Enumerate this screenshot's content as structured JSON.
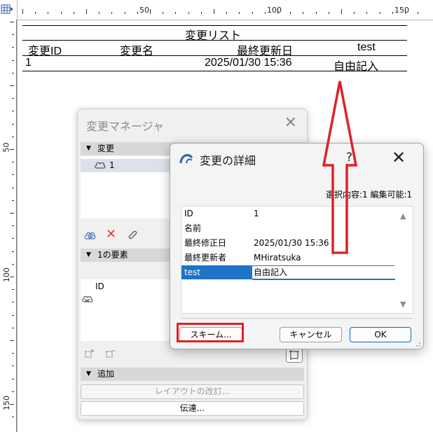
{
  "ruler": {
    "top_labels": [
      "50",
      "100",
      "150"
    ],
    "left_labels": [
      "50",
      "100",
      "150"
    ]
  },
  "change_list": {
    "title": "変更リスト",
    "columns": [
      "変更ID",
      "変更名",
      "最終更新日",
      "test"
    ],
    "rows": [
      {
        "id": "1",
        "name": "",
        "last_updated": "2025/01/30 15:36",
        "test": "自由記入"
      }
    ]
  },
  "change_manager": {
    "title": "変更マネージャ",
    "section_changes": "変更",
    "change_item": "1",
    "section_elements": "1の要素",
    "elements_column": "ID",
    "section_add": "追加",
    "layout_revision_button": "レイアウトの改訂...",
    "transmit_button": "伝達..."
  },
  "details_dialog": {
    "title": "変更の詳細",
    "help": "?",
    "status": "選択内容:1 編集可能:1",
    "properties": [
      {
        "key": "ID",
        "value": "1"
      },
      {
        "key": "名前",
        "value": ""
      },
      {
        "key": "最終修正日",
        "value": "2025/01/30 15:36"
      },
      {
        "key": "最終更新者",
        "value": "MHiratsuka"
      },
      {
        "key": "test",
        "value": "自由記入"
      }
    ],
    "scheme_button": "スキーム...",
    "cancel_button": "キャンセル",
    "ok_button": "OK"
  },
  "colors": {
    "highlight_red": "#e0202a",
    "selection_blue": "#1f73c7",
    "ok_border": "#0067c0"
  }
}
